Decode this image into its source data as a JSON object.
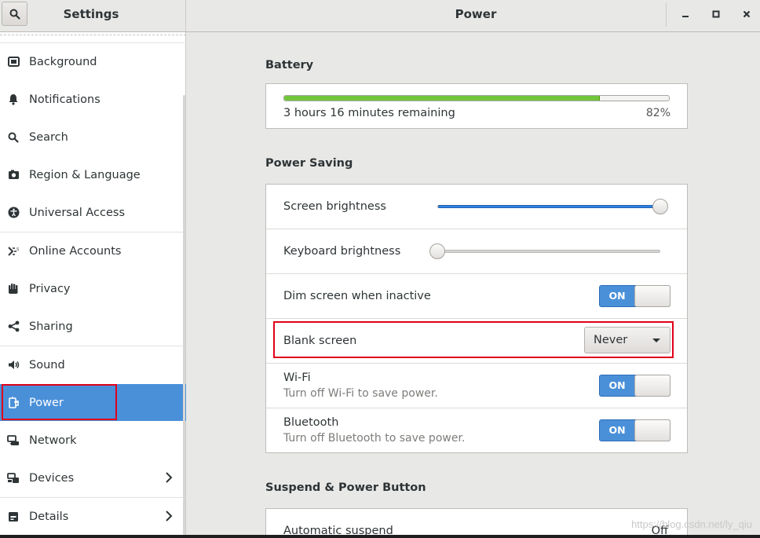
{
  "window": {
    "sidebar_title": "Settings",
    "panel_title": "Power",
    "minimize_icon": "minimize-icon",
    "maximize_icon": "maximize-icon",
    "close_icon": "close-icon"
  },
  "sidebar": {
    "items": [
      {
        "label": "Background",
        "icon": "image-icon"
      },
      {
        "label": "Notifications",
        "icon": "bell-icon"
      },
      {
        "label": "Search",
        "icon": "search-icon"
      },
      {
        "label": "Region & Language",
        "icon": "camera-icon"
      },
      {
        "label": "Universal Access",
        "icon": "accessibility-icon"
      },
      {
        "label": "Online Accounts",
        "icon": "online-accounts-icon"
      },
      {
        "label": "Privacy",
        "icon": "hand-icon"
      },
      {
        "label": "Sharing",
        "icon": "share-icon"
      },
      {
        "label": "Sound",
        "icon": "speaker-icon"
      },
      {
        "label": "Power",
        "icon": "power-plug-icon",
        "active": true
      },
      {
        "label": "Network",
        "icon": "network-icon"
      },
      {
        "label": "Devices",
        "icon": "devices-icon",
        "has_arrow": true
      },
      {
        "label": "Details",
        "icon": "details-icon",
        "has_arrow": true
      }
    ]
  },
  "battery": {
    "section_title": "Battery",
    "remaining_text": "3 hours 16 minutes remaining",
    "percent_text": "82%",
    "level": 0.82
  },
  "power_saving": {
    "section_title": "Power Saving",
    "screen_brightness_label": "Screen brightness",
    "screen_brightness_value": 1.0,
    "keyboard_brightness_label": "Keyboard brightness",
    "keyboard_brightness_value": 0.0,
    "dim_screen_label": "Dim screen when inactive",
    "dim_screen_state": "ON",
    "blank_screen_label": "Blank screen",
    "blank_screen_value": "Never",
    "wifi_label": "Wi-Fi",
    "wifi_sublabel": "Turn off Wi-Fi to save power.",
    "wifi_state": "ON",
    "bluetooth_label": "Bluetooth",
    "bluetooth_sublabel": "Turn off Bluetooth to save power.",
    "bluetooth_state": "ON"
  },
  "suspend": {
    "section_title": "Suspend & Power Button",
    "automatic_suspend_label": "Automatic suspend",
    "automatic_suspend_value": "Off"
  },
  "watermark": "https://blog.csdn.net/ly_qiu",
  "colors": {
    "accent": "#4a90d9",
    "highlight_box": "#e0001b",
    "battery_fill": "#73c63c"
  }
}
